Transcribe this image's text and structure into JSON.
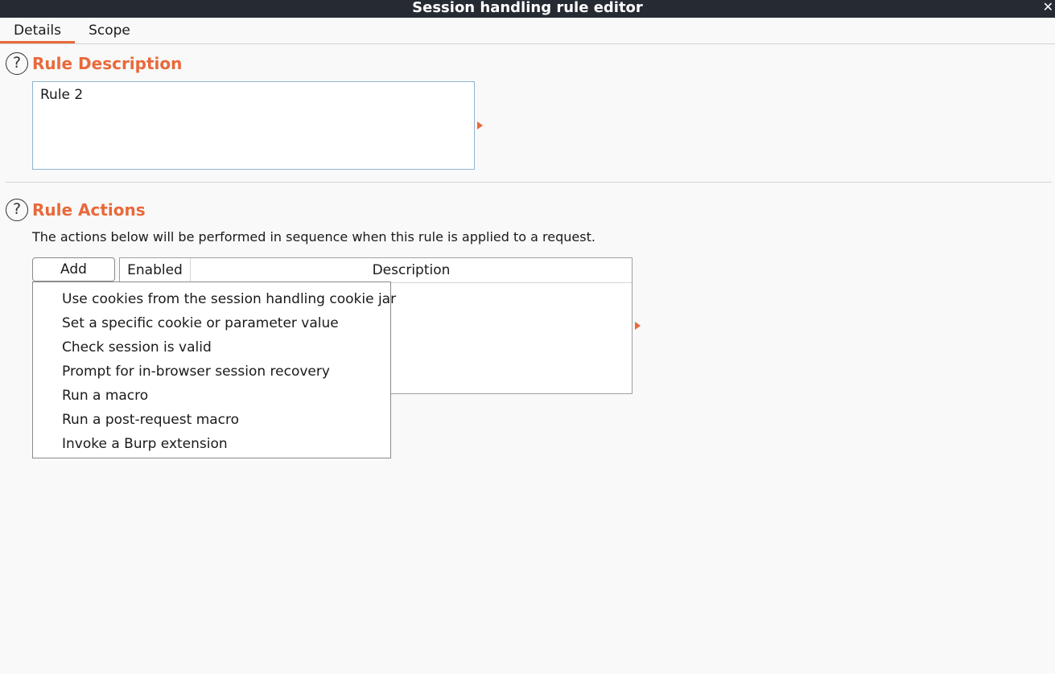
{
  "window": {
    "title": "Session handling rule editor",
    "close_glyph": "✕"
  },
  "tabs": [
    {
      "label": "Details",
      "active": true
    },
    {
      "label": "Scope",
      "active": false
    }
  ],
  "rule_description": {
    "heading": "Rule Description",
    "help_glyph": "?",
    "value": "Rule 2"
  },
  "rule_actions": {
    "heading": "Rule Actions",
    "help_glyph": "?",
    "info": "The actions below will be performed in sequence when this rule is applied to a request.",
    "add_label": "Add",
    "columns": [
      "Enabled",
      "Description"
    ],
    "rows": []
  },
  "add_menu": {
    "items": [
      "Use cookies from the session handling cookie jar",
      "Set a specific cookie or parameter value",
      "Check session is valid",
      "Prompt for in-browser session recovery",
      "Run a macro",
      "Run a post-request macro",
      "Invoke a Burp extension"
    ]
  },
  "colors": {
    "accent": "#e8693a",
    "titlebar_bg": "#262a33",
    "field_border": "#8fb4d0"
  }
}
